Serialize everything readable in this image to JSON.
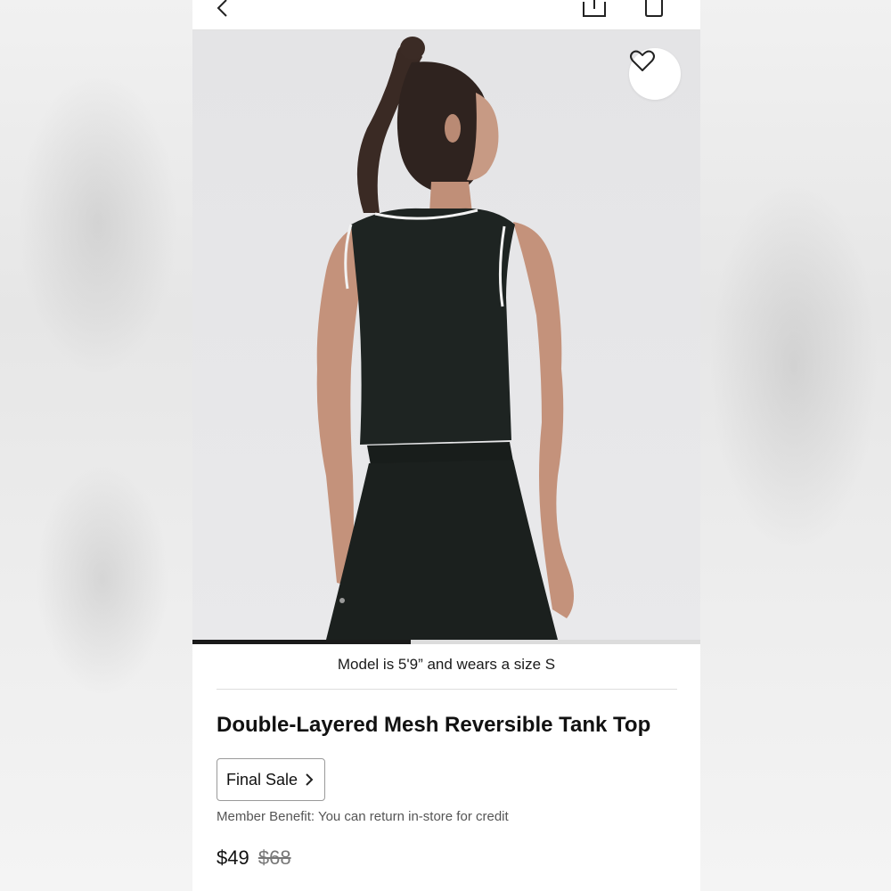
{
  "header": {
    "back_icon": "chevron-left-icon",
    "share_icon": "share-icon",
    "bag_icon": "shopping-bag-icon"
  },
  "hero": {
    "wishlist_icon": "heart-icon",
    "gallery_progress": 0.43
  },
  "product": {
    "model_caption": "Model is 5'9” and wears a size S",
    "title": "Double-Layered Mesh Reversible Tank Top",
    "final_sale_label": "Final Sale",
    "member_benefit": "Member Benefit: You can return in-store for credit",
    "price": "$49",
    "original_price": "$68"
  },
  "colors": {
    "accent": "#1a1a1a",
    "garment": "#1e2422",
    "background": "#e6e6e8"
  }
}
